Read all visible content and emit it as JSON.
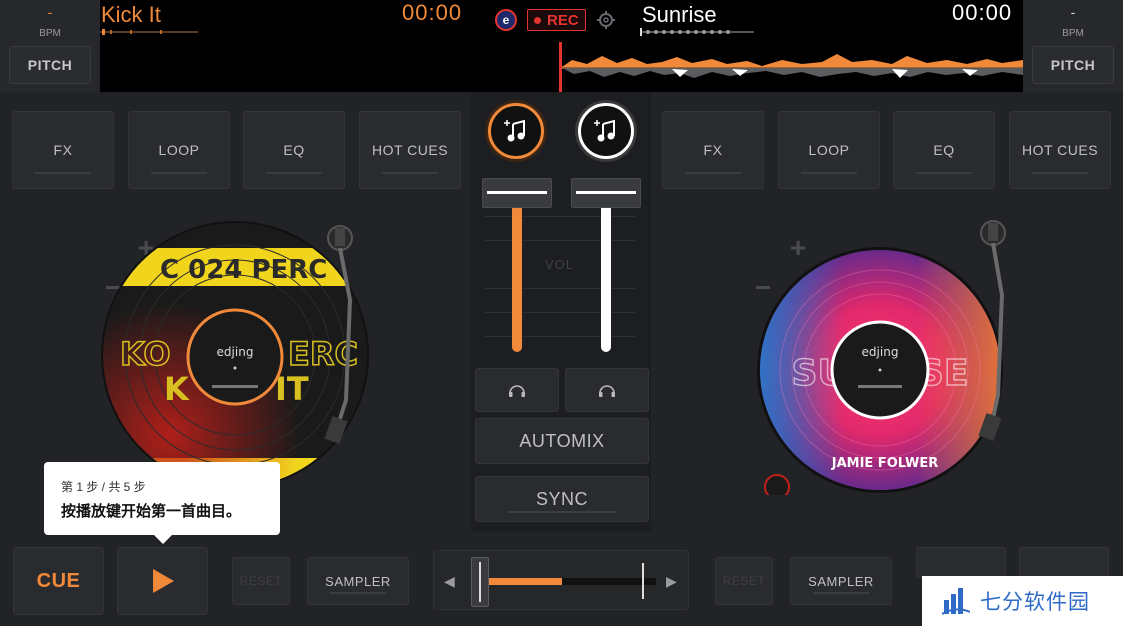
{
  "colors": {
    "accent_left": "#f08a3a",
    "accent_right": "#ffffff",
    "rec": "#e3342f",
    "watermark_blue": "#2f6bc6"
  },
  "deck_left": {
    "bpm_value": "-",
    "bpm_label": "BPM",
    "pitch_label": "PITCH",
    "title": "Kick It",
    "time": "00:00",
    "buttons": {
      "fx": "FX",
      "loop": "LOOP",
      "eq": "EQ",
      "hot_cues": "HOT CUES"
    },
    "vinyl_text": "KICK IT",
    "vinyl_brand": "edjing",
    "cue_label": "CUE",
    "reset_label": "RESET",
    "sampler_label": "SAMPLER"
  },
  "deck_right": {
    "bpm_value": "-",
    "bpm_label": "BPM",
    "pitch_label": "PITCH",
    "title": "Sunrise",
    "time": "00:00",
    "buttons": {
      "fx": "FX",
      "loop": "LOOP",
      "eq": "EQ",
      "hot_cues": "HOT CUES"
    },
    "vinyl_text": "SUNRISE",
    "vinyl_artist": "JAMIE FOLWER",
    "vinyl_brand": "edjing",
    "reset_label": "RESET",
    "sampler_label": "SAMPLER"
  },
  "header": {
    "rec_label": "REC",
    "logo_letter": "e",
    "icons": [
      "edjing-logo-icon",
      "gear-icon"
    ]
  },
  "mixer": {
    "vol_label": "VOL",
    "automix_label": "AUTOMIX",
    "sync_label": "SYNC",
    "icons": [
      "music-add-icon",
      "headphones-icon"
    ]
  },
  "tooltip": {
    "step": "第 1 步 / 共 5 步",
    "text": "按播放键开始第一首曲目。"
  },
  "watermark": {
    "text": "七分软件园"
  }
}
